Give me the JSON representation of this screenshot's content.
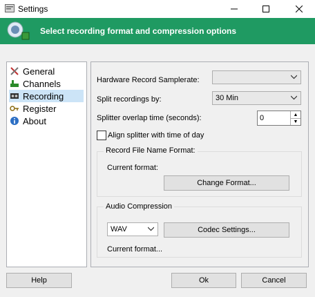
{
  "window": {
    "title": "Settings"
  },
  "banner": {
    "text": "Select recording format and compression options"
  },
  "sidebar": {
    "items": [
      {
        "label": "General",
        "icon": "tools-icon"
      },
      {
        "label": "Channels",
        "icon": "channels-icon"
      },
      {
        "label": "Recording",
        "icon": "recording-icon",
        "selected": true
      },
      {
        "label": "Register",
        "icon": "register-icon"
      },
      {
        "label": "About",
        "icon": "info-icon"
      }
    ]
  },
  "recording": {
    "samplerate_label": "Hardware Record Samplerate:",
    "samplerate_value": "",
    "split_label": "Split recordings by:",
    "split_value": "30 Min",
    "overlap_label": "Splitter overlap time (seconds):",
    "overlap_value": "0",
    "align_label": "Align splitter with time of day",
    "align_checked": false,
    "filename_group": "Record File Name Format:",
    "current_format_label": "Current format:",
    "change_format_button": "Change Format...",
    "audio_group": "Audio Compression",
    "codec_value": "WAV",
    "codec_settings_button": "Codec Settings...",
    "audio_current_format": "Current format..."
  },
  "footer": {
    "help": "Help",
    "ok": "Ok",
    "cancel": "Cancel"
  },
  "colors": {
    "banner": "#1f9a62",
    "selected": "#cce4f7"
  }
}
